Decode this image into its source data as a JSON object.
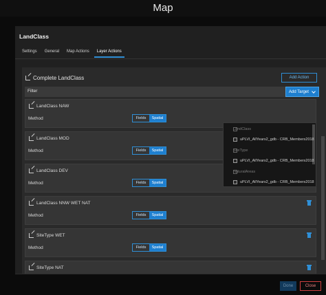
{
  "app": {
    "title": "Map"
  },
  "dialog": {
    "title": "LandClass",
    "tabs": [
      {
        "label": "Settings"
      },
      {
        "label": "General"
      },
      {
        "label": "Map Actions"
      },
      {
        "label": "Layer Actions"
      }
    ],
    "active_tab": "Layer Actions"
  },
  "action": {
    "title": "Complete LandClass",
    "add_action_label": "Add Action",
    "filter_label": "Filter",
    "add_target_label": "Add Target"
  },
  "targets": [
    {
      "name": "LandClass NAW",
      "method_label": "Method",
      "fields_label": "Fields",
      "spatial_label": "Spatial",
      "selected": "Spatial"
    },
    {
      "name": "LandClass MOD",
      "method_label": "Method",
      "fields_label": "Fields",
      "spatial_label": "Spatial",
      "selected": "Spatial"
    },
    {
      "name": "LandClass DEV",
      "method_label": "Method",
      "fields_label": "Fields",
      "spatial_label": "Spatial",
      "selected": "Spatial"
    },
    {
      "name": "LandClass NNW WET NAT",
      "method_label": "Method",
      "fields_label": "Fields",
      "spatial_label": "Spatial",
      "selected": "Spatial"
    },
    {
      "name": "SiteType WET",
      "method_label": "Method",
      "fields_label": "Fields",
      "spatial_label": "Spatial",
      "selected": "Spatial"
    },
    {
      "name": "SiteType NAT"
    }
  ],
  "dropdown": {
    "groups": [
      {
        "label": "LandClass",
        "item": "uPLVI_AllYears2_gdb - CRB_Members2018"
      },
      {
        "label": "SiteType",
        "item": "uPLVI_AllYears2_gdb - CRB_Members2018"
      },
      {
        "label": "NaturalAreas",
        "item": "uPLVI_AllYears2_gdb - CRB_Members2018"
      }
    ]
  },
  "footer": {
    "done_label": "Done",
    "close_label": "Close"
  },
  "colors": {
    "accent": "#1e7fcf",
    "danger": "#d04040",
    "panel": "#2a2a2a",
    "card": "#353535"
  }
}
